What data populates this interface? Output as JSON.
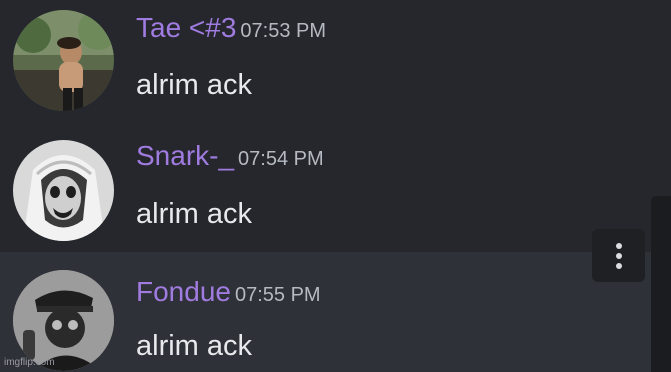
{
  "messages": [
    {
      "username": "Tae <#3",
      "timestamp": "07:53 PM",
      "content": "alrim ack",
      "username_color": "#a07be0",
      "avatar_icon": "user-avatar-photo-icon"
    },
    {
      "username": "Snark-_",
      "timestamp": "07:54 PM",
      "content": "alrim ack",
      "username_color": "#a07be0",
      "avatar_icon": "user-avatar-nun-icon"
    },
    {
      "username": "Fondue",
      "timestamp": "07:55 PM",
      "content": "alrim ack",
      "username_color": "#a07be0",
      "avatar_icon": "user-avatar-officer-icon"
    }
  ],
  "hover_actions": {
    "more_icon": "more-options-icon"
  },
  "watermark": "imgflip.com",
  "colors": {
    "background": "#25272d",
    "hover_background": "#2f3138",
    "username": "#a07be0",
    "text": "#e8e9ec",
    "timestamp": "#b5b9c0"
  }
}
